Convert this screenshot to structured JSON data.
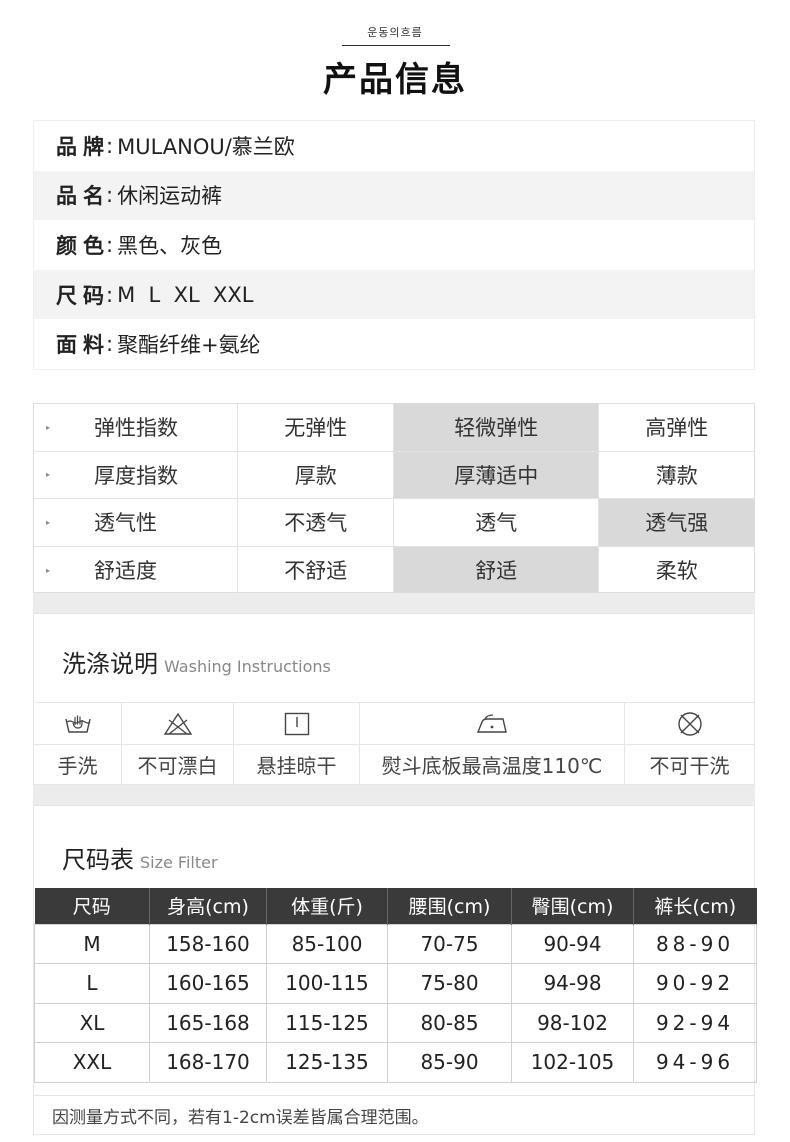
{
  "header": {
    "small_text": "운동의흐름",
    "title": "产品信息"
  },
  "info": [
    {
      "label": "品牌",
      "value": "MULANOU/慕兰欧"
    },
    {
      "label": "品名",
      "value": "休闲运动裤"
    },
    {
      "label": "颜色",
      "value": "黑色、灰色"
    },
    {
      "label": "尺码",
      "value": "M  L  XL  XXL"
    },
    {
      "label": "面料",
      "value": "聚酯纤维+氨纶"
    }
  ],
  "ratings": [
    {
      "name": "弹性指数",
      "options": [
        "无弹性",
        "轻微弹性",
        "高弹性"
      ],
      "selected": 1
    },
    {
      "name": "厚度指数",
      "options": [
        "厚款",
        "厚薄适中",
        "薄款"
      ],
      "selected": 1
    },
    {
      "name": "透气性",
      "options": [
        "不透气",
        "透气",
        "透气强"
      ],
      "selected": 2
    },
    {
      "name": "舒适度",
      "options": [
        "不舒适",
        "舒适",
        "柔软"
      ],
      "selected": 1
    }
  ],
  "colors": {
    "selected_cell": "#d9d9d9",
    "table_header": "#3a3a3a"
  },
  "washing": {
    "title": "洗涤说明",
    "title_en": "Washing Instructions",
    "items": [
      {
        "icon": "hand-wash-icon",
        "label": "手洗"
      },
      {
        "icon": "no-bleach-icon",
        "label": "不可漂白"
      },
      {
        "icon": "hang-dry-icon",
        "label": "悬挂晾干"
      },
      {
        "icon": "iron-icon",
        "label": "熨斗底板最高温度110℃"
      },
      {
        "icon": "no-dry-clean-icon",
        "label": "不可干洗"
      }
    ]
  },
  "size_chart": {
    "title": "尺码表",
    "title_en": "Size Filter",
    "headers": [
      "尺码",
      "身高(cm)",
      "体重(斤)",
      "腰围(cm)",
      "臀围(cm)",
      "裤长(cm)"
    ],
    "rows": [
      [
        "M",
        "158-160",
        "85-100",
        "70-75",
        "90-94",
        "88-90"
      ],
      [
        "L",
        "160-165",
        "100-115",
        "75-80",
        "94-98",
        "90-92"
      ],
      [
        "XL",
        "165-168",
        "115-125",
        "80-85",
        "98-102",
        "92-94"
      ],
      [
        "XXL",
        "168-170",
        "125-135",
        "85-90",
        "102-105",
        "94-96"
      ]
    ],
    "note": "因测量方式不同，若有1-2cm误差皆属合理范围。"
  }
}
